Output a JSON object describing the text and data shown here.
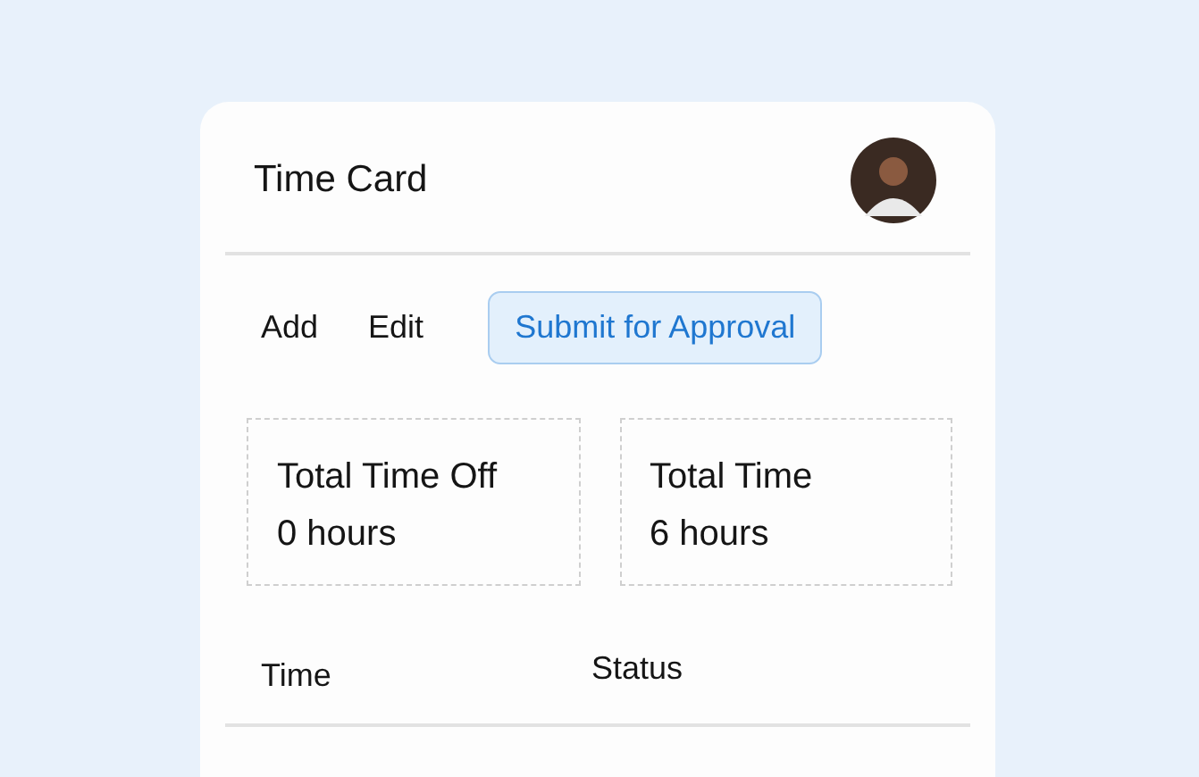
{
  "card": {
    "title": "Time Card"
  },
  "actions": [
    {
      "label": "Add",
      "kind": "text"
    },
    {
      "label": "Edit",
      "kind": "text"
    },
    {
      "label": "Submit for Approval",
      "kind": "primary"
    }
  ],
  "summary": [
    {
      "label": "Total Time Off",
      "value": "0 hours"
    },
    {
      "label": "Total Time",
      "value": "6 hours"
    }
  ],
  "table": {
    "columns": [
      "Time",
      "Status"
    ]
  }
}
